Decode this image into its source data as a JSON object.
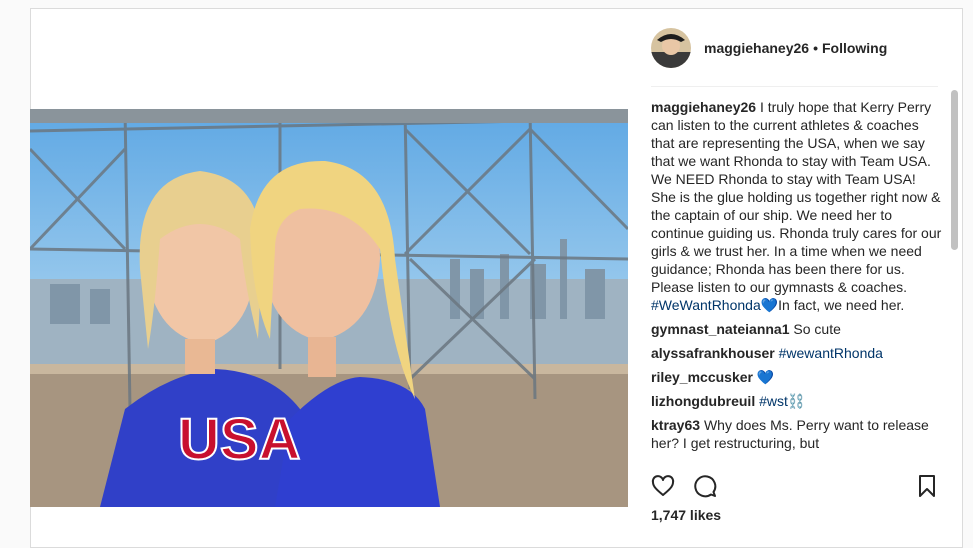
{
  "post": {
    "username": "maggiehaney26",
    "follow_status": "Following",
    "separator": "•",
    "likes": "1,747 likes"
  },
  "caption": {
    "username": "maggiehaney26",
    "text": "I truly hope that Kerry Perry can listen to the current athletes & coaches that are representing the USA, when we say that we want Rhonda to stay with Team USA. We NEED Rhonda to stay with Team USA! She is the glue holding us together right now & the captain of our ship. We need her to continue guiding us. Rhonda truly cares for our girls & we trust her. In a time when we need guidance; Rhonda has been there for us. Please listen to our gymnasts & coaches.",
    "hashtag": "#WeWantRhonda",
    "emoji": "💙",
    "tail": "In fact, we need her."
  },
  "comments": [
    {
      "username": "gymnast_nateianna1",
      "text": "So cute"
    },
    {
      "username": "alyssafrankhouser",
      "hashtag": "#wewantRhonda"
    },
    {
      "username": "riley_mccusker",
      "emoji": "💙"
    },
    {
      "username": "lizhongdubreuil",
      "hashtag": "#wst",
      "emoji": "⛓️"
    },
    {
      "username": "ktray63",
      "text": "Why does Ms. Perry want to release her? I get restructuring, but"
    }
  ],
  "photo": {
    "shirt_text": "USA"
  },
  "icons": {
    "like": "heart-outline-icon",
    "comment": "comment-bubble-icon",
    "save": "bookmark-icon"
  },
  "colors": {
    "link": "#003569",
    "shirt": "#2f3fd0",
    "sky": "#8fc3ea"
  }
}
